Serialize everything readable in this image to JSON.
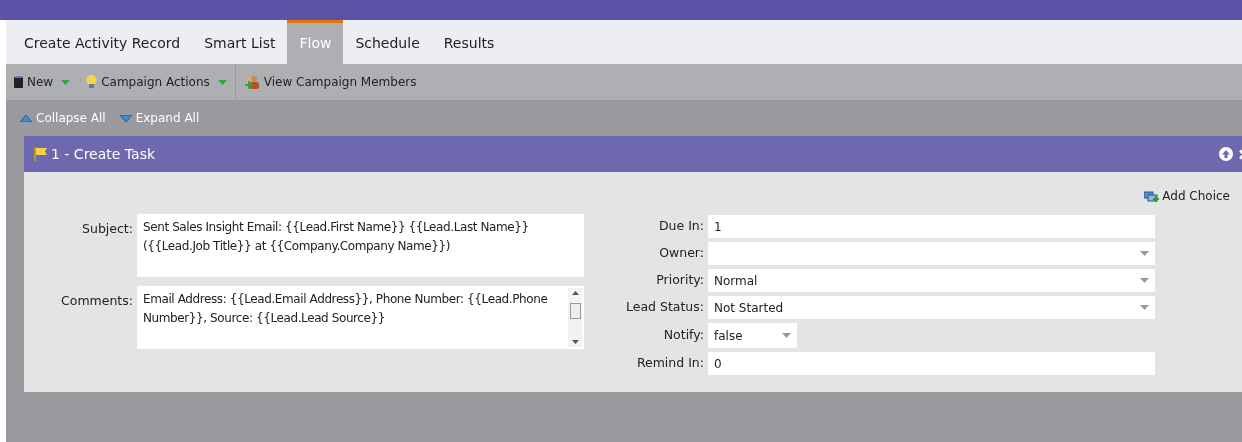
{
  "tabs": [
    {
      "label": "Create Activity Record",
      "selected": false
    },
    {
      "label": "Smart List",
      "selected": false
    },
    {
      "label": "Flow",
      "selected": true
    },
    {
      "label": "Schedule",
      "selected": false
    },
    {
      "label": "Results",
      "selected": false
    }
  ],
  "toolbar": [
    {
      "label": "New",
      "kind": "new",
      "dropdown": true
    },
    {
      "label": "Campaign Actions",
      "kind": "bulb",
      "dropdown": true
    },
    {
      "label": "View Campaign Members",
      "kind": "people",
      "dropdown": false
    }
  ],
  "flow_toolbar": [
    {
      "label": "Collapse All",
      "kind": "collapse"
    },
    {
      "label": "Expand All",
      "kind": "expand"
    }
  ],
  "step": {
    "title": "1 - Create Task",
    "add_choice": "Add Choice",
    "left_fields": [
      {
        "label": "Subject:",
        "value": "Sent Sales Insight Email: {{Lead.First Name}} {{Lead.Last Name}} ({{Lead.Job Title}} at {{Company.Company Name}})",
        "kind": "textarea",
        "scrollbar": false
      },
      {
        "label": "Comments:",
        "value": "Email Address: {{Lead.Email Address}}, Phone Number: {{Lead.Phone Number}}, Source: {{Lead.Lead Source}}",
        "kind": "textarea",
        "scrollbar": true
      }
    ],
    "right_fields": [
      {
        "label": "Due In:",
        "value": "1",
        "kind": "text"
      },
      {
        "label": "Owner:",
        "kind": "select"
      },
      {
        "label": "Priority:",
        "value": "Normal",
        "kind": "select"
      },
      {
        "label": "Lead Status:",
        "value": "Not Started",
        "kind": "select"
      },
      {
        "label": "Notify:",
        "value": "false",
        "kind": "small-select"
      },
      {
        "label": "Remind In:",
        "value": "0",
        "kind": "text"
      }
    ]
  }
}
